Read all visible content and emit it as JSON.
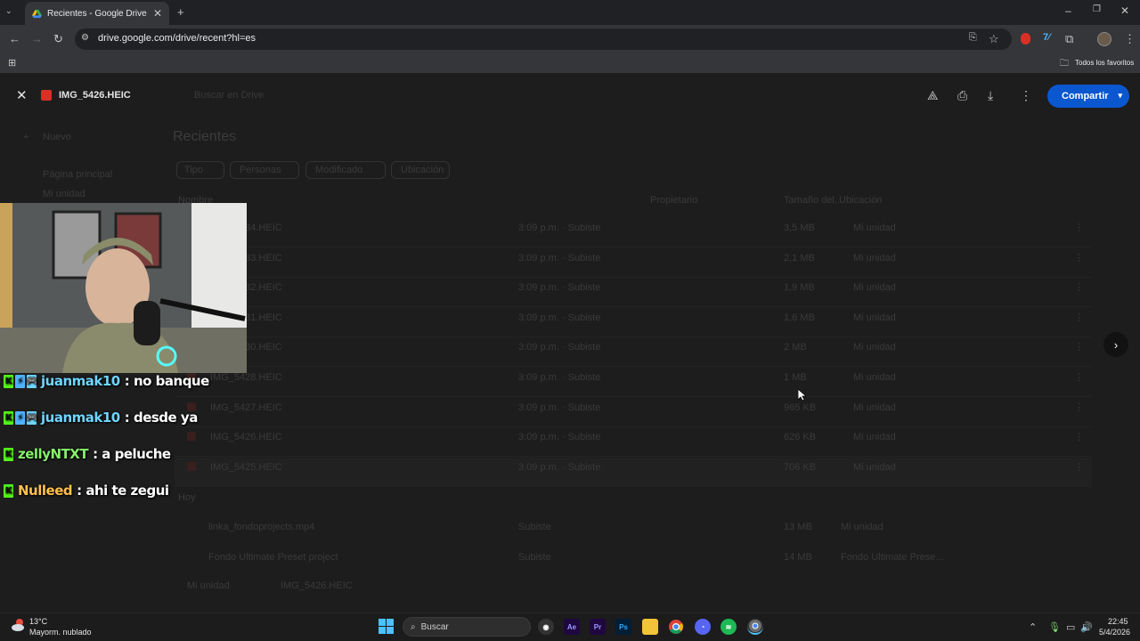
{
  "browser": {
    "tab_title": "Recientes - Google Drive",
    "url": "drive.google.com/drive/recent?hl=es",
    "bookmarks_label": "Todos los favoritos"
  },
  "viewer": {
    "file_name": "IMG_5426.HEIC",
    "share_label": "Compartir"
  },
  "drive_background": {
    "search_placeholder": "Buscar en Drive",
    "new_label": "Nuevo",
    "page_title": "Recientes",
    "nav": [
      "Página principal",
      "Mi unidad"
    ],
    "filters": [
      "Tipo",
      "Personas",
      "Modificado",
      "Ubicación"
    ],
    "columns": {
      "name": "Nombre",
      "owner": "Propietario",
      "size": "Tamaño del...",
      "location": "Ubicación"
    },
    "rows": [
      {
        "name": "IMG_5434.HEIC",
        "date": "3:09 p.m. · Subiste",
        "size": "3,5 MB",
        "location": "Mi unidad"
      },
      {
        "name": "IMG_5433.HEIC",
        "date": "3:09 p.m. · Subiste",
        "size": "2,1 MB",
        "location": "Mi unidad"
      },
      {
        "name": "IMG_5432.HEIC",
        "date": "3:09 p.m. · Subiste",
        "size": "1,9 MB",
        "location": "Mi unidad"
      },
      {
        "name": "IMG_5431.HEIC",
        "date": "3:09 p.m. · Subiste",
        "size": "1,6 MB",
        "location": "Mi unidad"
      },
      {
        "name": "IMG_5430.HEIC",
        "date": "3:09 p.m. · Subiste",
        "size": "2 MB",
        "location": "Mi unidad"
      },
      {
        "name": "IMG_5428.HEIC",
        "date": "3:09 p.m. · Subiste",
        "size": "1 MB",
        "location": "Mi unidad"
      },
      {
        "name": "IMG_5427.HEIC",
        "date": "3:09 p.m. · Subiste",
        "size": "965 KB",
        "location": "Mi unidad"
      },
      {
        "name": "IMG_5426.HEIC",
        "date": "3:09 p.m. · Subiste",
        "size": "626 KB",
        "location": "Mi unidad"
      },
      {
        "name": "IMG_5425.HEIC",
        "date": "3:09 p.m. · Subiste",
        "size": "706 KB",
        "location": "Mi unidad"
      }
    ],
    "section_label": "Hoy",
    "rows_older": [
      {
        "name": "linka_fondoprojects.mp4",
        "date": "Subiste",
        "size": "13 MB",
        "location": "Mi unidad"
      },
      {
        "name": "Fondo Ultimate Preset project",
        "date": "Subiste",
        "size": "14 MB",
        "location": "Fondo Ultimate Prese..."
      }
    ],
    "breadcrumb": [
      "Mi unidad",
      "IMG_5426.HEIC"
    ]
  },
  "chat": [
    {
      "user": "juanmak10",
      "msg": ": no banque",
      "color": "#6fd5ff",
      "badges": [
        "K",
        "⚡",
        "🎮"
      ]
    },
    {
      "user": "juanmak10",
      "msg": ": desde ya",
      "color": "#6fd5ff",
      "badges": [
        "K",
        "⚡",
        "🎮"
      ]
    },
    {
      "user": "zellyNTXT",
      "msg": ": a peluche",
      "color": "#86f06a",
      "badges": [
        "K"
      ]
    },
    {
      "user": "Nulleed",
      "msg": ": ahi te zegui",
      "color": "#ffc14d",
      "badges": [
        "K"
      ]
    }
  ],
  "taskbar": {
    "weather_temp": "13°C",
    "weather_desc": "Mayorm. nublado",
    "search_label": "Buscar",
    "time": "22:45",
    "date": "5/4/2026",
    "apps": [
      "Ae",
      "Pr",
      "Ps"
    ]
  },
  "colors": {
    "accent": "#0b57d0",
    "chrome_bg": "#35363a",
    "page_dim": "#1d1d1d"
  }
}
